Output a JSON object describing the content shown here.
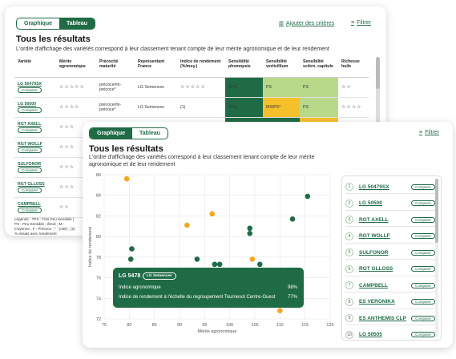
{
  "back": {
    "toggle": {
      "graph": "Graphique",
      "table": "Tableau"
    },
    "add_criteria": "Ajouter des critères",
    "filter": "Filtrer",
    "title": "Tous les résultats",
    "subtitle": "L'ordre d'affichage des variétés correspond à leur classement tenant compte de leur mérite agronomique et de leur rendement",
    "columns": [
      "Variété",
      "Mérite agronomique",
      "Précocité maturité",
      "Représentant France",
      "Indice de rendement (%/moy.)",
      "Sensibilité phomopsis",
      "Sensibilité verticillium",
      "Sensibilité scléro. capitule",
      "Richesse huile"
    ],
    "compare": "Comparer",
    "rows": [
      {
        "name": "LG 50479SX",
        "merit": "☆☆☆☆☆",
        "prec": "précoce/mi-précoce*",
        "rep": "LG Semences",
        "yield": "☆☆☆☆☆",
        "phom": "TPS",
        "vert": "PS",
        "scle": "PS",
        "oil": "☆☆"
      },
      {
        "name": "LG 50500",
        "merit": "☆☆☆☆",
        "prec": "précoce/mi-précoce*",
        "rep": "LG Semences",
        "yield": "(1)",
        "phom": "TPS",
        "vert": "MS/PS*",
        "scle": "PS",
        "oil": "☆☆☆☆"
      },
      {
        "name": "RGT AXELL",
        "merit": "☆☆☆",
        "prec": "",
        "rep": "",
        "yield": "",
        "phom": "",
        "vert": "",
        "scle": "",
        "oil": ""
      },
      {
        "name": "RGT WOLLF",
        "merit": "☆☆☆",
        "prec": "",
        "rep": "",
        "yield": "",
        "phom": "",
        "vert": "",
        "scle": "",
        "oil": ""
      },
      {
        "name": "SULFONOR",
        "merit": "☆☆☆",
        "prec": "",
        "rep": "",
        "yield": "",
        "phom": "",
        "vert": "",
        "scle": "",
        "oil": ""
      },
      {
        "name": "RGT GLLOSS",
        "merit": "☆☆☆",
        "prec": "",
        "rep": "",
        "yield": "",
        "phom": "",
        "vert": "",
        "scle": "",
        "oil": ""
      },
      {
        "name": "CAMPBELL",
        "merit": "☆☆",
        "prec": "",
        "rep": "",
        "yield": "",
        "phom": "",
        "vert": "",
        "scle": "",
        "oil": ""
      }
    ],
    "legend": "Légende : TPS : Très Peu Sensible | PS : Peu Sensible ; élevé ; M : moyenne ; F : Précoce ; * : (c80) ; (2) % essais avec rendement"
  },
  "front": {
    "toggle": {
      "graph": "Graphique",
      "table": "Tableau"
    },
    "filter": "Filtrer",
    "title": "Tous les résultats",
    "subtitle": "L'ordre d'affichage des variétés correspond à leur classement tenant compte de leur mérite agronomique et de leur rendement",
    "tooltip": {
      "name": "LG 5478",
      "tag": "LG Semences",
      "row1_label": "Indice agronomique",
      "row1_value": "98%",
      "row2_label": "Indice de rendement à l'échelle du regroupement Tournesol Centre-Ouest",
      "row2_value": "77%"
    },
    "list": [
      {
        "n": "1",
        "name": "LG 50479SX"
      },
      {
        "n": "2",
        "name": "LG 50500"
      },
      {
        "n": "3",
        "name": "RGT AXELL"
      },
      {
        "n": "4",
        "name": "RGT WOLLF"
      },
      {
        "n": "5",
        "name": "SULFONOR"
      },
      {
        "n": "6",
        "name": "RGT GLLOSS"
      },
      {
        "n": "7",
        "name": "CAMPBELL"
      },
      {
        "n": "8",
        "name": "ES VERONIKA"
      },
      {
        "n": "9",
        "name": "ES ANTHEMIS CLP"
      },
      {
        "n": "10",
        "name": "LG 50505"
      }
    ],
    "compare": "Comparer"
  },
  "colors": {
    "green_dark": "#1f6b45",
    "orange": "#f5a623"
  },
  "chart_data": {
    "type": "scatter",
    "xlabel": "Mérite agronomique",
    "ylabel": "Indice de rendement",
    "xlim": [
      75,
      120
    ],
    "ylim": [
      72,
      86
    ],
    "xticks": [
      75,
      80,
      85,
      90,
      95,
      100,
      105,
      110,
      115,
      120
    ],
    "yticks": [
      72,
      74,
      76,
      78,
      80,
      82,
      84,
      86
    ],
    "grid": true,
    "series": [
      {
        "color": "#1f6b45",
        "points": [
          [
            80.5,
            78.8
          ],
          [
            80.3,
            77.8
          ],
          [
            81.0,
            75.7
          ],
          [
            93.5,
            77.8
          ],
          [
            95.0,
            73.8
          ],
          [
            97.0,
            77.3
          ],
          [
            98.0,
            77.3
          ],
          [
            99.0,
            76.7
          ],
          [
            101.0,
            74.5
          ],
          [
            104.0,
            80.8
          ],
          [
            104.0,
            80.3
          ],
          [
            104.5,
            75.0
          ],
          [
            106.0,
            77.3
          ],
          [
            112.5,
            81.7
          ],
          [
            115.5,
            83.9
          ]
        ]
      },
      {
        "color": "#f5a623",
        "points": [
          [
            79.5,
            85.6
          ],
          [
            91.5,
            81.1
          ],
          [
            96.5,
            82.2
          ],
          [
            104.5,
            77.8
          ],
          [
            109.0,
            73.5
          ],
          [
            110.0,
            72.8
          ]
        ]
      }
    ]
  }
}
